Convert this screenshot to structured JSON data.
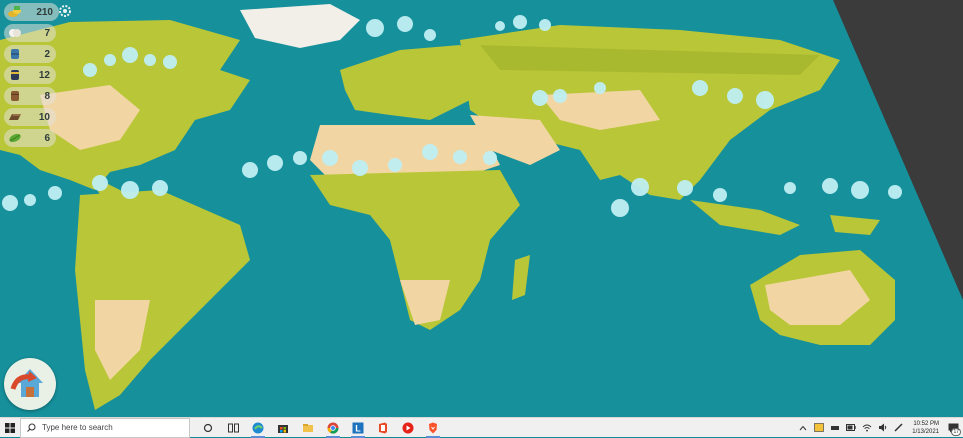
{
  "resources": [
    {
      "icon": "coins-icon",
      "value": "210"
    },
    {
      "icon": "cotton-icon",
      "value": "7"
    },
    {
      "icon": "water-barrel-icon",
      "value": "2"
    },
    {
      "icon": "fuel-barrel-icon",
      "value": "12"
    },
    {
      "icon": "wood-bundle-icon",
      "value": "8"
    },
    {
      "icon": "iron-ingot-icon",
      "value": "10"
    },
    {
      "icon": "leaf-icon",
      "value": "6"
    }
  ],
  "colors": {
    "ocean": "#16909b",
    "land_green": "#b9c637",
    "land_sand": "#f1d6a4",
    "cloud": "#bfeff3",
    "dark_edge": "#3b3b3b"
  },
  "taskbar": {
    "search_placeholder": "Type here to search",
    "time": "10:52 PM",
    "date": "1/13/2021",
    "notification_count": "17",
    "apps": [
      "task-view-icon",
      "edge-icon",
      "store-icon",
      "file-explorer-icon",
      "chrome-icon",
      "launcher-l-icon",
      "office-icon",
      "youtube-music-icon",
      "brave-icon"
    ]
  }
}
